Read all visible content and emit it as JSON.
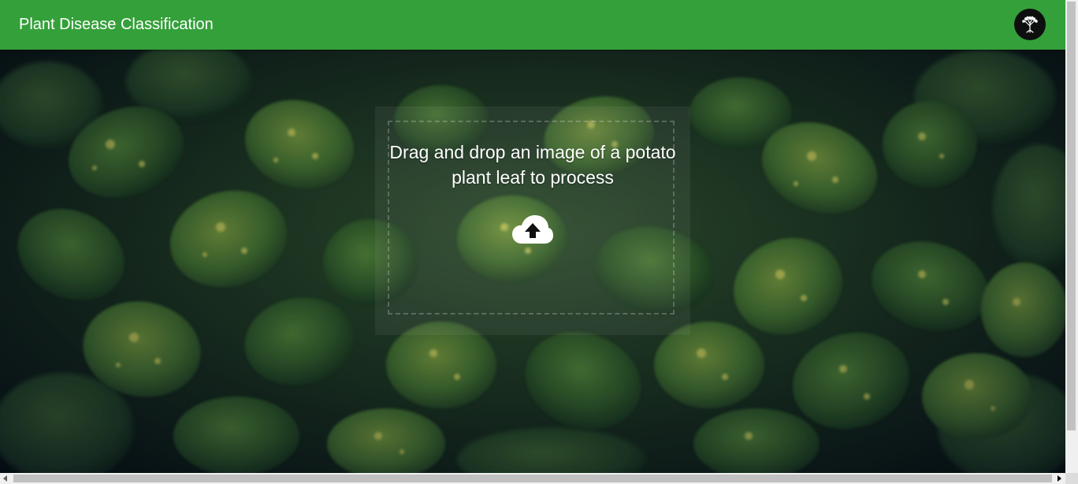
{
  "appbar": {
    "title": "Plant Disease Classification",
    "color": "#34a03a"
  },
  "avatar": {
    "icon": "tree-logo-icon"
  },
  "dropzone": {
    "prompt": "Drag and drop an image of a potato plant leaf to process",
    "icon": "cloud-upload-icon"
  }
}
